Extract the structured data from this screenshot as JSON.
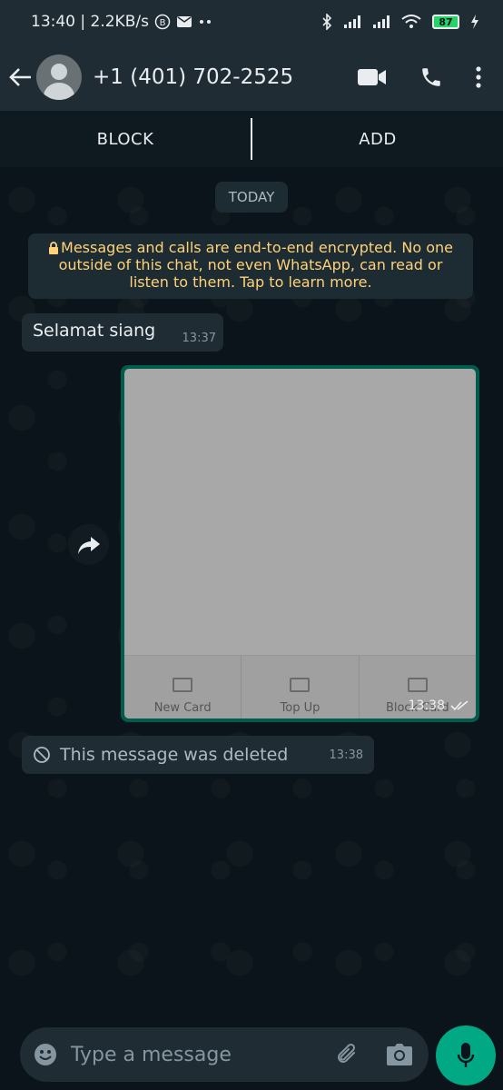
{
  "status_bar": {
    "time_speed": "13:40 | 2.2KB/s",
    "battery": "87",
    "icons": [
      "b-icon",
      "mail-icon",
      "more-dots-icon",
      "bluetooth-icon",
      "signal-icon",
      "signal-icon",
      "wifi-icon",
      "battery-icon",
      "charging-icon"
    ]
  },
  "toolbar": {
    "contact_name": "+1 (401) 702-2525",
    "icons": [
      "back-arrow-icon",
      "avatar-icon",
      "video-call-icon",
      "phone-call-icon",
      "more-vert-icon"
    ]
  },
  "action_bar": {
    "block_label": "BLOCK",
    "add_label": "ADD"
  },
  "chat": {
    "date_chip": "TODAY",
    "encryption_notice": "Messages and calls are end-to-end encrypted. No one outside of this chat, not even WhatsApp, can read or listen to them. Tap to learn more.",
    "messages": [
      {
        "type": "incoming-text",
        "text": "Selamat siang",
        "time": "13:37"
      },
      {
        "type": "outgoing-image",
        "time": "13:38",
        "status": "delivered",
        "buttons": [
          "New Card",
          "Top Up",
          "Block Card"
        ]
      },
      {
        "type": "incoming-deleted",
        "text": "This message was deleted",
        "time": "13:38"
      }
    ]
  },
  "composer": {
    "placeholder": "Type a message"
  },
  "colors": {
    "header": "#1f2c34",
    "chat_bg": "#0b141a",
    "outgoing": "#005c4b",
    "accent": "#00a884",
    "notice_text": "#ffd279"
  }
}
